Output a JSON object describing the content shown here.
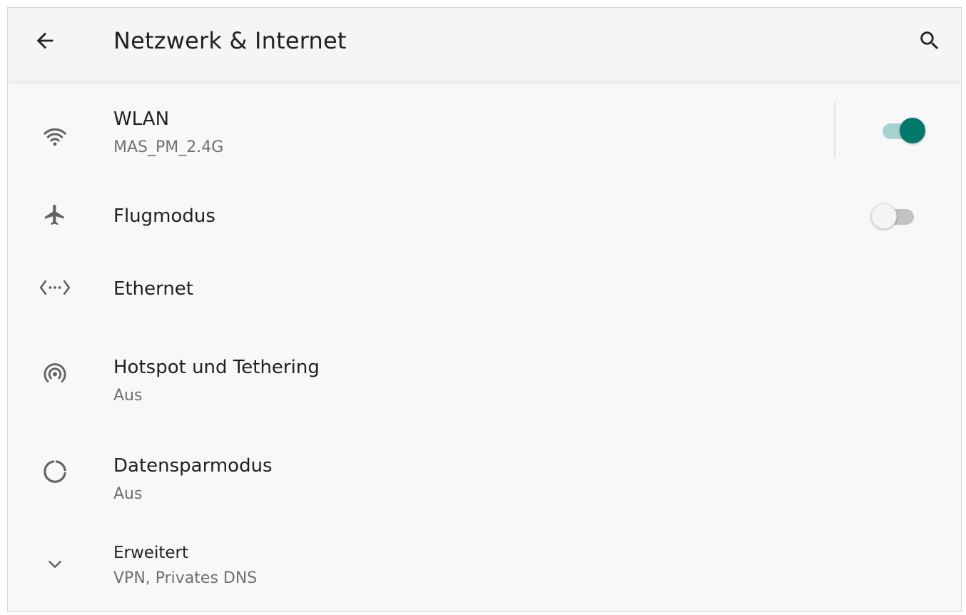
{
  "app_bar": {
    "title": "Netzwerk & Internet",
    "back_icon": "arrow-left-icon",
    "search_icon": "search-icon"
  },
  "items": [
    {
      "id": "wlan",
      "label": "WLAN",
      "summary": "MAS_PM_2.4G",
      "icon": "wifi-icon",
      "toggle": true
    },
    {
      "id": "airplane",
      "label": "Flugmodus",
      "icon": "airplane-icon",
      "toggle": false
    },
    {
      "id": "ethernet",
      "label": "Ethernet",
      "icon": "ethernet-icon"
    },
    {
      "id": "hotspot",
      "label": "Hotspot und Tethering",
      "summary": "Aus",
      "icon": "hotspot-icon"
    },
    {
      "id": "datasaver",
      "label": "Datensparmodus",
      "summary": "Aus",
      "icon": "data-saver-icon"
    },
    {
      "id": "advanced",
      "label": "Erweitert",
      "summary": "VPN, Privates DNS",
      "icon": "chevron-down-icon"
    }
  ],
  "colors": {
    "accent": "#00796b",
    "accent_track": "#a6d3cf",
    "text_primary": "#202124",
    "text_secondary": "#707070",
    "icon": "#5f6368"
  }
}
